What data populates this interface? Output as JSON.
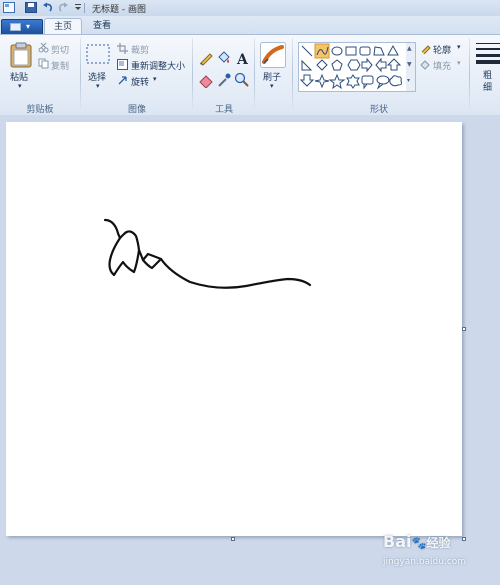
{
  "window": {
    "title": "无标题 - 画图"
  },
  "tabs": [
    {
      "label": "主页",
      "active": true
    },
    {
      "label": "查看",
      "active": false
    }
  ],
  "clipboard": {
    "paste": "粘贴",
    "cut": "剪切",
    "copy": "复制",
    "group": "剪贴板"
  },
  "image": {
    "select": "选择",
    "crop": "裁剪",
    "resize": "重新调整大小",
    "rotate": "旋转",
    "group": "图像"
  },
  "tools": {
    "group": "工具"
  },
  "brushes": {
    "label": "刷子"
  },
  "shapes": {
    "outline": "轮廓",
    "fill": "填充",
    "group": "形状"
  },
  "size": {
    "label": "粗细"
  },
  "watermark": {
    "brand": "Bai",
    "brand2": "经验",
    "sub": "jingyan.baidu.com"
  },
  "colors": {
    "accent": "#1d4f9e",
    "ribbon": "#e7eef8",
    "selected_shape": "#f5c46a"
  }
}
